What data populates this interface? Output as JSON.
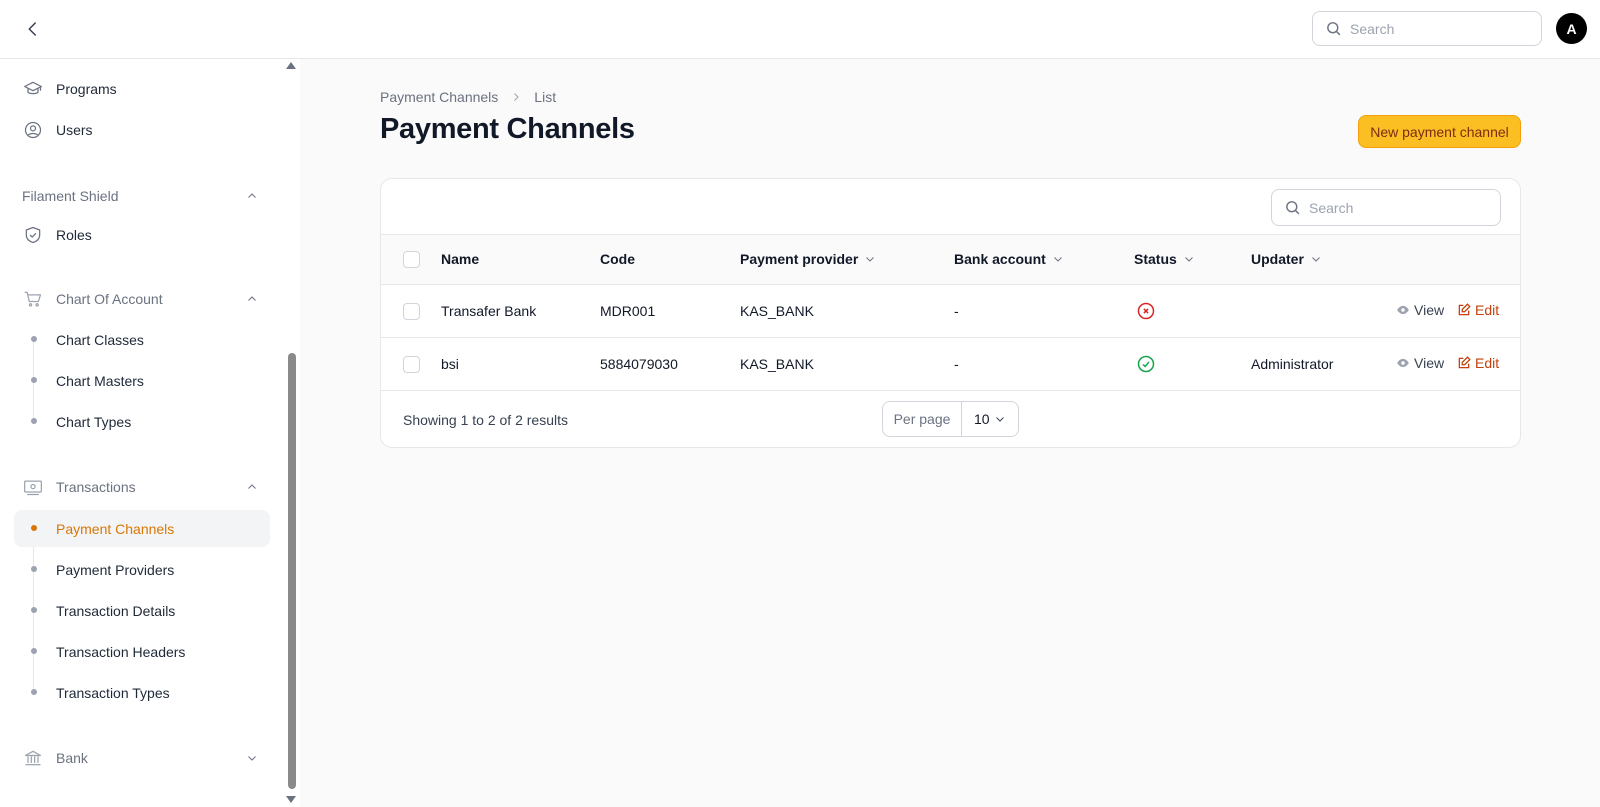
{
  "topbar": {
    "search_placeholder": "Search",
    "avatar_initial": "A"
  },
  "sidebar": {
    "items_top": [
      {
        "label": "Programs",
        "icon": "graduation-cap-icon"
      },
      {
        "label": "Users",
        "icon": "user-circle-icon"
      }
    ],
    "groups": [
      {
        "label": "Filament Shield",
        "expanded": true,
        "items": [
          {
            "label": "Roles",
            "icon": "shield-check-icon"
          }
        ]
      },
      {
        "label": "Chart Of Account",
        "icon": "shopping-cart-icon",
        "expanded": true,
        "items": [
          "Chart Classes",
          "Chart Masters",
          "Chart Types"
        ]
      },
      {
        "label": "Transactions",
        "icon": "banknotes-icon",
        "expanded": true,
        "items": [
          "Payment Channels",
          "Payment Providers",
          "Transaction Details",
          "Transaction Headers",
          "Transaction Types"
        ],
        "active": "Payment Channels"
      },
      {
        "label": "Bank",
        "icon": "building-library-icon",
        "expanded": false
      }
    ]
  },
  "breadcrumb": [
    "Payment Channels",
    "List"
  ],
  "page_title": "Payment Channels",
  "new_button_label": "New payment channel",
  "table": {
    "search_placeholder": "Search",
    "columns": [
      "Name",
      "Code",
      "Payment provider",
      "Bank account",
      "Status",
      "Updater"
    ],
    "rows": [
      {
        "name": "Transafer Bank",
        "code": "MDR001",
        "provider": "KAS_BANK",
        "bank_account": "-",
        "status": "inactive",
        "updater": ""
      },
      {
        "name": "bsi",
        "code": "5884079030",
        "provider": "KAS_BANK",
        "bank_account": "-",
        "status": "active",
        "updater": "Administrator"
      }
    ],
    "actions": {
      "view": "View",
      "edit": "Edit"
    },
    "footer": {
      "summary": "Showing 1 to 2 of 2 results",
      "per_page_label": "Per page",
      "per_page_value": "10"
    }
  },
  "colors": {
    "accent": "#fbbf24",
    "active_nav": "#d97706",
    "status_active": "#16a34a",
    "status_inactive": "#dc2626",
    "edit_action": "#c2410c"
  }
}
